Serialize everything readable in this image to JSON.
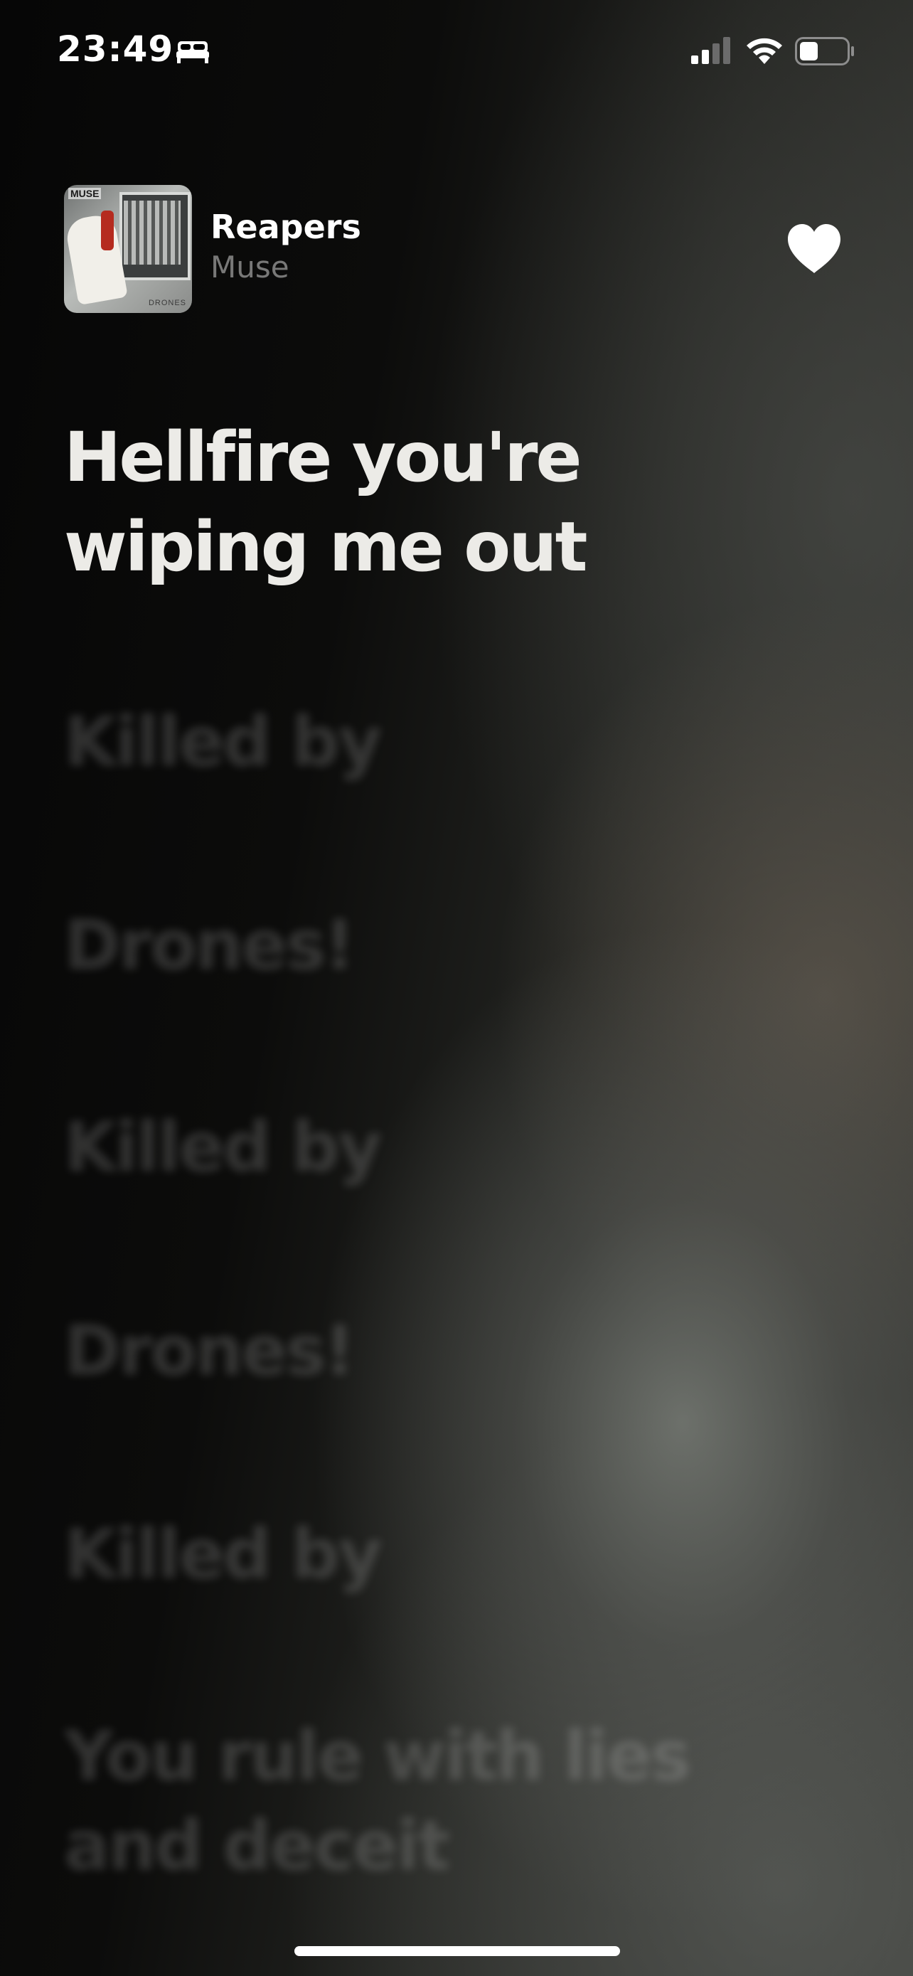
{
  "status_bar": {
    "time": "23:49",
    "icons": [
      "bed-icon",
      "cellular-signal-icon",
      "wifi-icon",
      "battery-icon"
    ]
  },
  "now_playing": {
    "title": "Reapers",
    "artist": "Muse",
    "artwork": {
      "band_text": "MUSE",
      "album_text": "DRONES"
    },
    "favorite_icon": "heart-icon"
  },
  "lyrics": {
    "active_line": "Hellfire you're\nwiping me out",
    "upcoming_lines": [
      "Killed by",
      "Drones!",
      "Killed by",
      "Drones!",
      "Killed by",
      "You rule with lies\nand deceit"
    ]
  },
  "colors": {
    "lyric_active": "#ecebe7",
    "artist_secondary": "#8a8a8a",
    "background": "#050505"
  }
}
